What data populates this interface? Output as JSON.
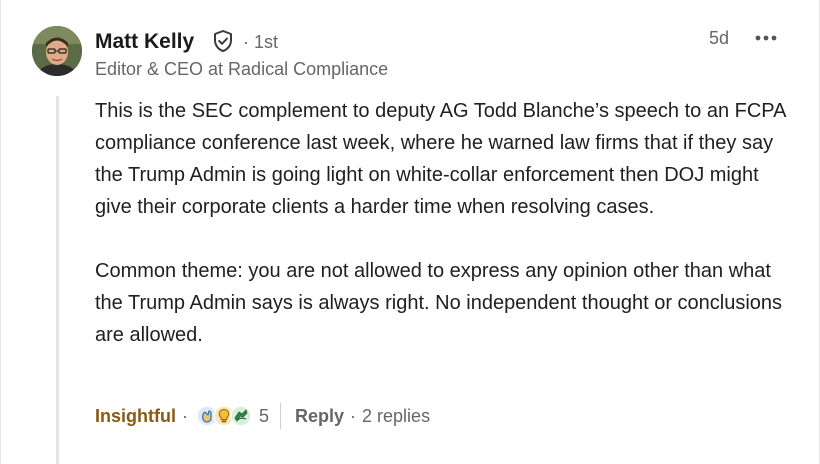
{
  "comment": {
    "author": {
      "name": "Matt Kelly",
      "degree": "· 1st",
      "headline": "Editor & CEO at Radical Compliance"
    },
    "timestamp": "5d",
    "more_label": "•••",
    "paragraphs": [
      "This is the SEC complement to deputy AG Todd Blanche’s speech to an FCPA compliance conference last week, where he warned law firms that if they say the Trump Admin is going light on white-collar enforcement then DOJ might give their corporate clients a harder time when resolving cases.",
      "Common theme: you are not allowed to express any opinion other than what the Trump Admin says is always right. No independent thought or conclusions are allowed."
    ],
    "actions": {
      "reaction_label": "Insightful",
      "sep": "·",
      "reaction_icons": [
        "clap-icon",
        "lightbulb-icon",
        "support-icon"
      ],
      "reaction_count": "5",
      "reply_label": "Reply",
      "replies_text": "2 replies"
    }
  },
  "colors": {
    "insightful": "#8a5a12",
    "muted_text": "#666666",
    "body_text": "#1f1f1f",
    "thread_line": "#e4e4e4"
  }
}
